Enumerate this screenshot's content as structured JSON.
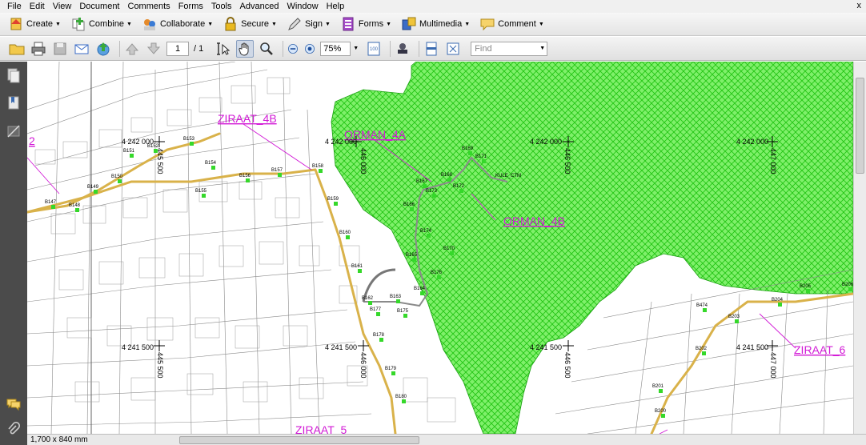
{
  "menu": [
    "File",
    "Edit",
    "View",
    "Document",
    "Comments",
    "Forms",
    "Tools",
    "Advanced",
    "Window",
    "Help"
  ],
  "window_close": "x",
  "toolbar": {
    "create": "Create",
    "combine": "Combine",
    "collaborate": "Collaborate",
    "secure": "Secure",
    "sign": "Sign",
    "forms": "Forms",
    "multimedia": "Multimedia",
    "comment": "Comment"
  },
  "nav": {
    "page_current": "1",
    "page_total": "/ 1",
    "zoom": "75%",
    "find_placeholder": "Find"
  },
  "status": {
    "page_size": "1,700 x 840 mm"
  },
  "map": {
    "zones": [
      {
        "id": "ziraat-4b",
        "label": "ZIRAAT_4B"
      },
      {
        "id": "orman-4a",
        "label": "ORMAN_4A"
      },
      {
        "id": "orman-4b",
        "label": "ORMAN_4B"
      },
      {
        "id": "ziraat-6",
        "label": "ZIRAAT_6"
      },
      {
        "id": "ziraat-5",
        "label": "ZIRAAT_5"
      },
      {
        "id": "zone-2",
        "label": "2"
      }
    ],
    "coordinates": [
      {
        "id": "n4242000-a",
        "label": "4 242 000"
      },
      {
        "id": "n4242000-b",
        "label": "4 242 000"
      },
      {
        "id": "n4242000-c",
        "label": "4 242 000"
      },
      {
        "id": "n4242000-d",
        "label": "4 242 000"
      },
      {
        "id": "n4241500-a",
        "label": "4 241 500"
      },
      {
        "id": "n4241500-b",
        "label": "4 241 500"
      },
      {
        "id": "n4241500-c",
        "label": "4 241 500"
      },
      {
        "id": "n4241500-d",
        "label": "4 241 500"
      },
      {
        "id": "e445500-a",
        "label": "445 500"
      },
      {
        "id": "e446000-a",
        "label": "446 000"
      },
      {
        "id": "e446500-a",
        "label": "446 500"
      },
      {
        "id": "e447000-a",
        "label": "447 000"
      },
      {
        "id": "e445500-b",
        "label": "445 500"
      },
      {
        "id": "e446000-b",
        "label": "446 000"
      },
      {
        "id": "e446500-b",
        "label": "446 500"
      },
      {
        "id": "e447000-b",
        "label": "447 000"
      }
    ],
    "points": [
      "B147",
      "B148",
      "B149",
      "B150",
      "B151",
      "B152",
      "B153",
      "B154",
      "B155",
      "B156",
      "B157",
      "B158",
      "B159",
      "B160",
      "B161",
      "B162",
      "B163",
      "B164",
      "B165",
      "B166",
      "B167",
      "B168",
      "B169",
      "B170",
      "B171",
      "B172",
      "B173",
      "B174",
      "B175",
      "B176",
      "B177",
      "B178",
      "B179",
      "B180",
      "B200",
      "B201",
      "B202",
      "B203",
      "B204",
      "B205",
      "B206",
      "B474"
    ],
    "small_labels": [
      "KULE_CTM"
    ]
  },
  "colors": {
    "forest": "#2ad614",
    "road": "#d9b24a",
    "zone_label": "#d21ad6",
    "point": "#35d82a",
    "parcel": "#8a8a8a"
  }
}
